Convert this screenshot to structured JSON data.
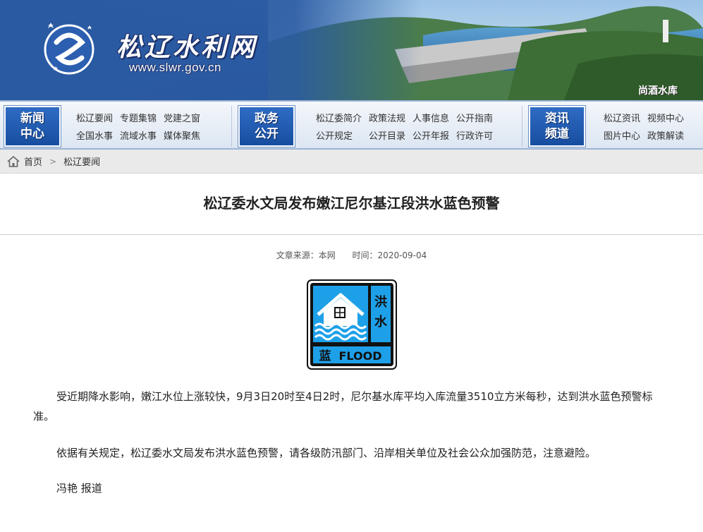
{
  "site": {
    "name_cn": "松辽水利网",
    "url": "www.slwr.gov.cn",
    "photo_caption": "尚酒水库"
  },
  "nav": {
    "blocks": [
      {
        "badge": [
          "新闻",
          "中心"
        ],
        "links": [
          "松辽要闻",
          "专题集锦",
          "党建之窗",
          "全国水事",
          "流域水事",
          "媒体聚焦"
        ]
      },
      {
        "badge": [
          "政务",
          "公开"
        ],
        "links": [
          "松辽委简介",
          "政策法规",
          "人事信息",
          "公开指南",
          "公开规定",
          "公开目录",
          "公开年报",
          "行政许可"
        ]
      },
      {
        "badge": [
          "资讯",
          "频道"
        ],
        "links": [
          "松辽资讯",
          "视频中心",
          "图片中心",
          "政策解读"
        ]
      }
    ]
  },
  "breadcrumb": {
    "home": "首页",
    "current": "松辽要闻"
  },
  "article": {
    "title": "松辽委水文局发布嫩江尼尔基江段洪水蓝色预警",
    "source": "文章来源：本网",
    "time": "时间：2020-09-04",
    "badge": {
      "side_text": [
        "洪",
        "水"
      ],
      "bottom_cn": "蓝",
      "bottom_en": "FLOOD",
      "color": "#1ea0e8"
    },
    "paragraphs": [
      "受近期降水影响，嫩江水位上涨较快，9月3日20时至4日2时，尼尔基水库平均入库流量3510立方米每秒，达到洪水蓝色预警标准。",
      "依据有关规定，松辽委水文局发布洪水蓝色预警，请各级防汛部门、沿岸相关单位及社会公众加强防范，注意避险。",
      "冯艳 报道"
    ]
  }
}
